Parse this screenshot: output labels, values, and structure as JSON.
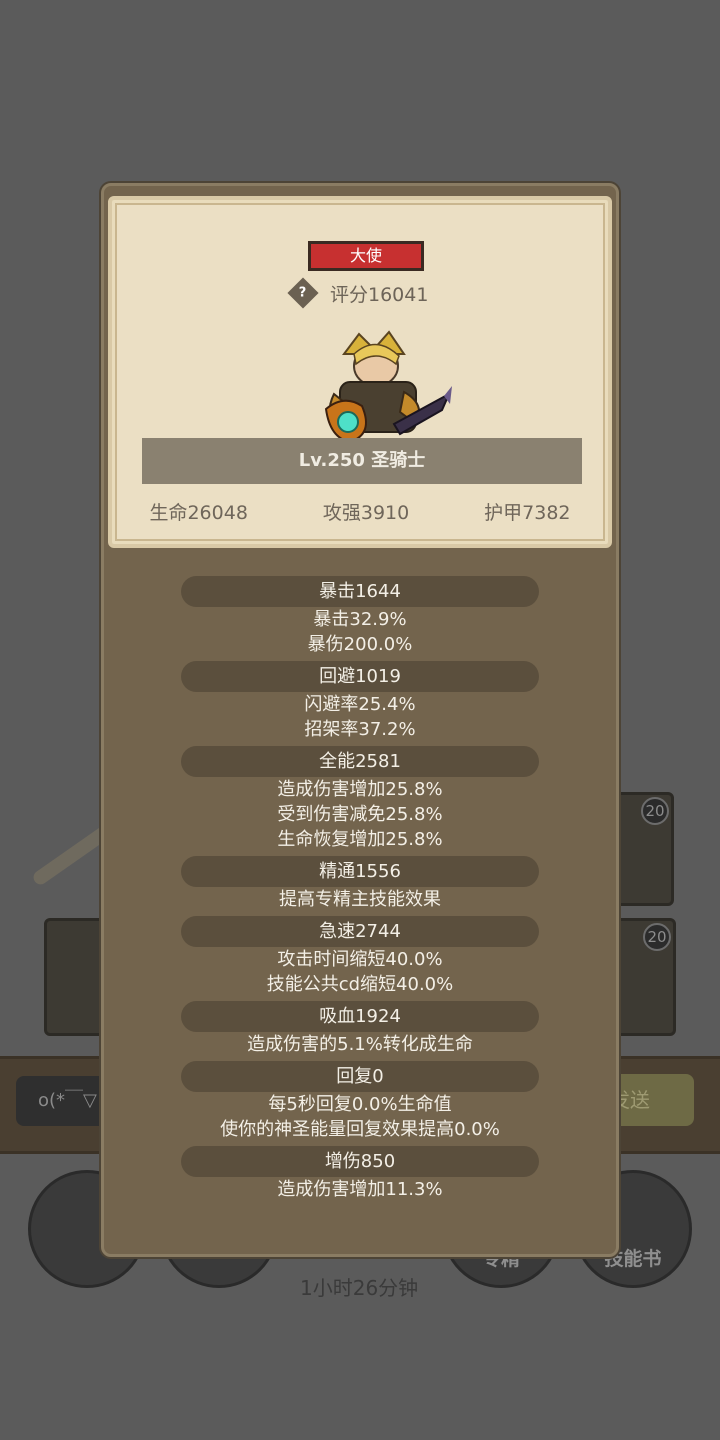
{
  "background": {
    "input_text": "o(*￣▽",
    "send_label": "发送",
    "slot_level": "20",
    "timer": "1小时26分钟",
    "buttons": [
      "专精",
      "技能书"
    ]
  },
  "card": {
    "rank": "大使",
    "score": "评分16041",
    "name": "Lv.250 圣骑士",
    "base_stats": [
      "生命26048",
      "攻强3910",
      "护甲7382"
    ]
  },
  "groups": [
    {
      "title": "暴击1644",
      "lines": [
        "暴击32.9%",
        "暴伤200.0%"
      ]
    },
    {
      "title": "回避1019",
      "lines": [
        "闪避率25.4%",
        "招架率37.2%"
      ]
    },
    {
      "title": "全能2581",
      "lines": [
        "造成伤害增加25.8%",
        "受到伤害减免25.8%",
        "生命恢复增加25.8%"
      ]
    },
    {
      "title": "精通1556",
      "lines": [
        "提高专精主技能效果"
      ]
    },
    {
      "title": "急速2744",
      "lines": [
        "攻击时间缩短40.0%",
        "技能公共cd缩短40.0%"
      ]
    },
    {
      "title": "吸血1924",
      "lines": [
        "造成伤害的5.1%转化成生命"
      ]
    },
    {
      "title": "回复0",
      "lines": [
        "每5秒回复0.0%生命值",
        "使你的神圣能量回复效果提高0.0%"
      ]
    },
    {
      "title": "增伤850",
      "lines": [
        "造成伤害增加11.3%"
      ]
    }
  ]
}
